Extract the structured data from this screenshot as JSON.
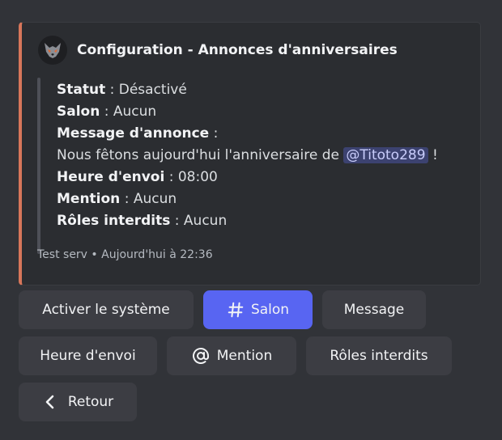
{
  "embed": {
    "accent_color": "#d7765a",
    "avatar_icon": "wolf-logo-icon",
    "title": "Configuration - Annonces d'anniversaires",
    "fields": {
      "statut_label": "Statut",
      "statut_value": "Désactivé",
      "salon_label": "Salon",
      "salon_value": "Aucun",
      "message_label": "Message d'annonce",
      "message_text": "Nous fêtons aujourd'hui l'anniversaire de",
      "message_mention": "@Titoto289",
      "message_end": "!",
      "heure_label": "Heure d'envoi",
      "heure_value": "08:00",
      "mention_label": "Mention",
      "mention_value": "Aucun",
      "roles_label": "Rôles interdits",
      "roles_value": "Aucun"
    },
    "footer": {
      "server": "Test serv",
      "timestamp": "Aujourd'hui à 22:36"
    }
  },
  "buttons": {
    "activate": "Activer le système",
    "salon": "Salon",
    "message": "Message",
    "heure": "Heure d'envoi",
    "mention": "Mention",
    "roles": "Rôles interdits",
    "back": "Retour"
  },
  "colors": {
    "background": "#313338",
    "embed_background": "#2b2d31",
    "button": "#3c3d43",
    "button_primary": "#5865f2",
    "mention_bg": "#3c4270"
  }
}
